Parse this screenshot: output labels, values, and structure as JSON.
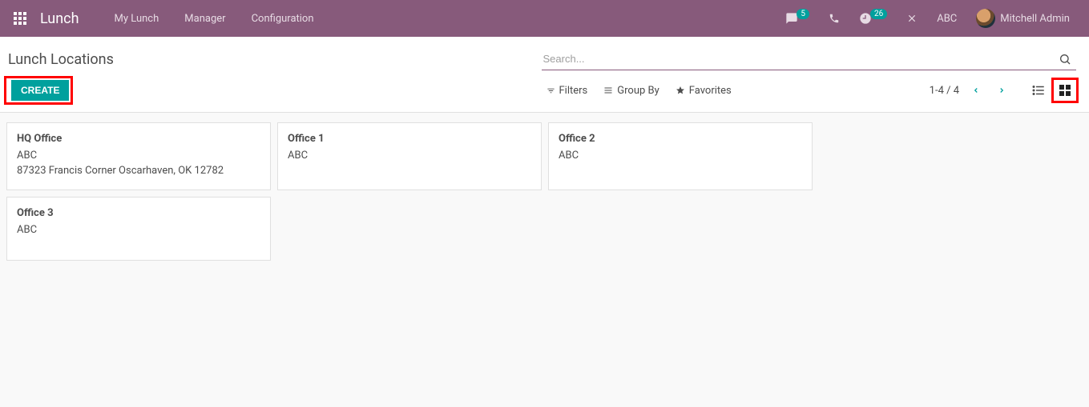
{
  "navbar": {
    "brand": "Lunch",
    "links": [
      "My Lunch",
      "Manager",
      "Configuration"
    ],
    "messages_badge": "5",
    "activity_badge": "26",
    "company_short": "ABC",
    "user_name": "Mitchell Admin"
  },
  "breadcrumb": "Lunch Locations",
  "search": {
    "placeholder": "Search..."
  },
  "buttons": {
    "create": "Create"
  },
  "filters": {
    "filters_label": "Filters",
    "group_by_label": "Group By",
    "favorites_label": "Favorites"
  },
  "pager": {
    "text": "1-4 / 4"
  },
  "cards": [
    {
      "title": "HQ Office",
      "company": "ABC",
      "address": "87323 Francis Corner Oscarhaven, OK 12782"
    },
    {
      "title": "Office 1",
      "company": "ABC",
      "address": ""
    },
    {
      "title": "Office 2",
      "company": "ABC",
      "address": ""
    },
    {
      "title": "Office 3",
      "company": "ABC",
      "address": ""
    }
  ]
}
